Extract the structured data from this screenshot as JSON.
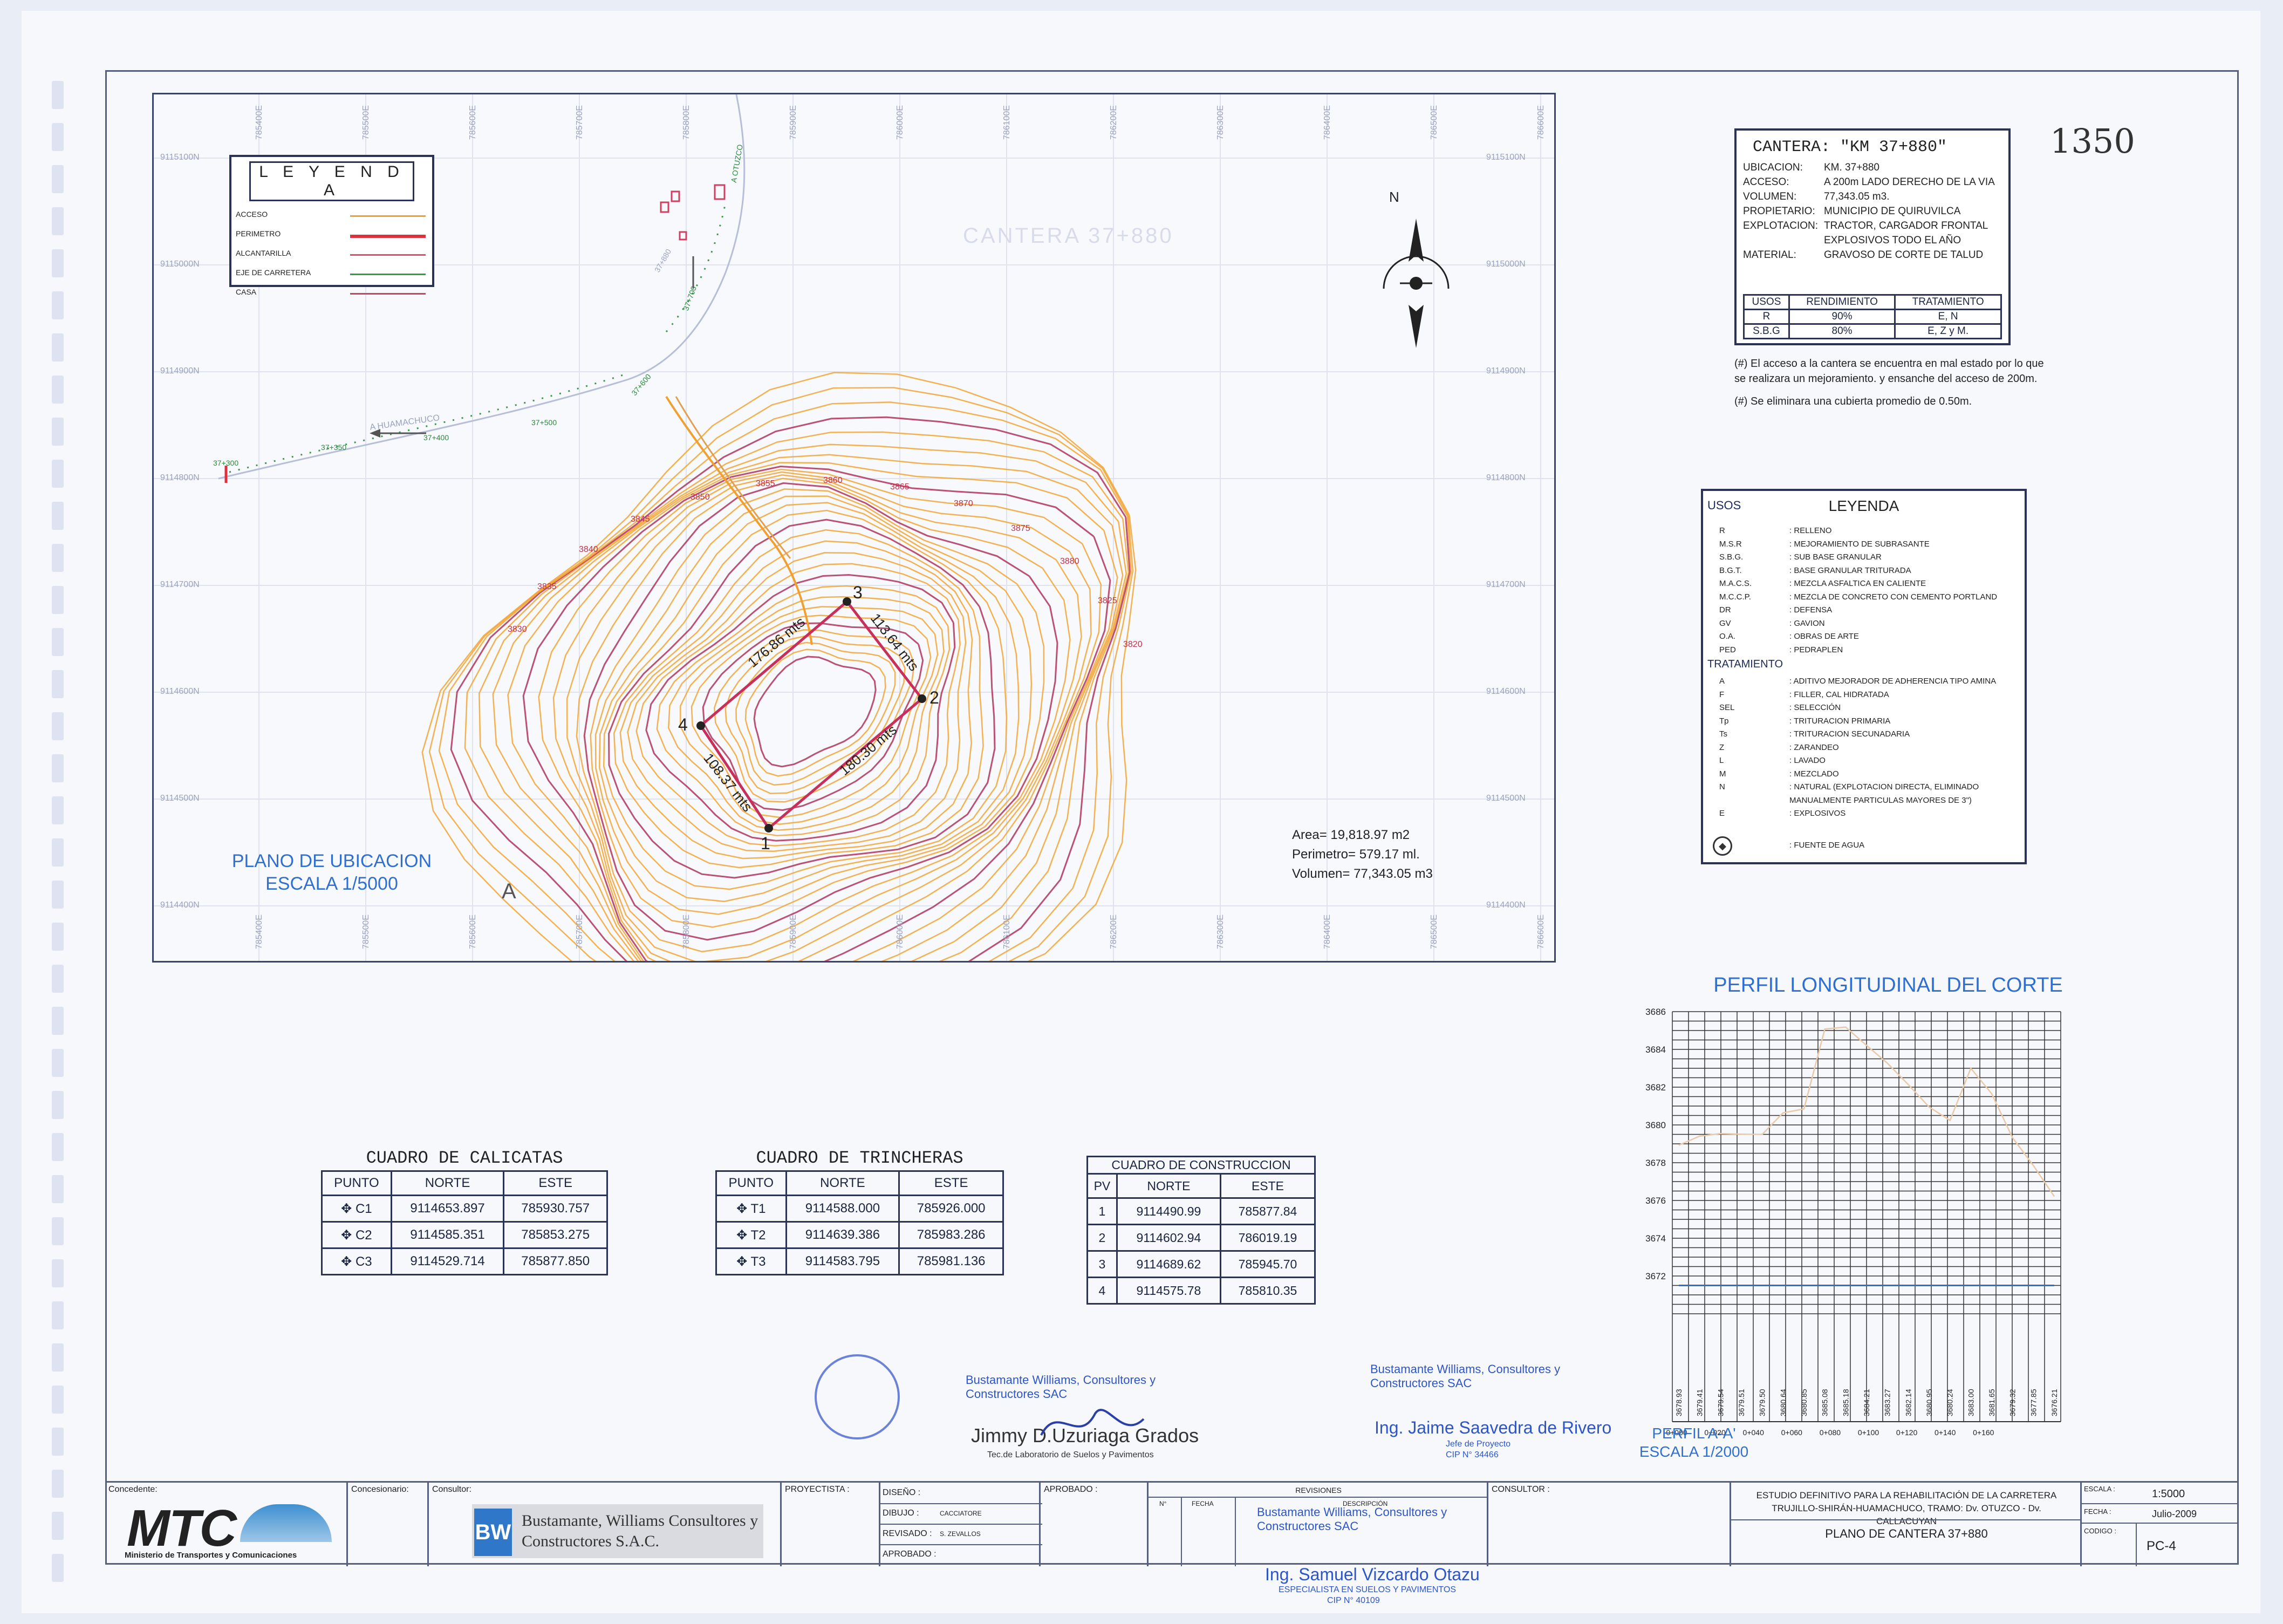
{
  "sheet_number": "1350",
  "map": {
    "north_label": "N",
    "legend_title": "L E Y E N D A",
    "legend_items": [
      {
        "label": "ACCESO",
        "color": "#f0a030"
      },
      {
        "label": "PERIMETRO",
        "color": "#e03040"
      },
      {
        "label": "ALCANTARILLA",
        "color": "#e84a6a"
      },
      {
        "label": "EJE DE CARRETERA",
        "color": "#30a040"
      },
      {
        "label": "CASA",
        "color": "#d04060"
      }
    ],
    "faint_title": "CANTERA 37+880",
    "easting_ticks": [
      "785400E",
      "785500E",
      "785600E",
      "785700E",
      "785800E",
      "785900E",
      "786000E",
      "786100E",
      "786200E",
      "786300E",
      "786400E",
      "786500E",
      "786600E"
    ],
    "northing_ticks": [
      "9115100N",
      "9115000N",
      "9114900N",
      "9114800N",
      "9114700N",
      "9114600N",
      "9114500N",
      "9114400N"
    ],
    "road_labels": [
      "37+300",
      "37+350",
      "37+400",
      "37+500",
      "37+600",
      "37+700",
      "A OTUZCO",
      "A HUAMACHUCO",
      "37+880"
    ],
    "distances": [
      "176.86 mts",
      "113.64 mts",
      "180.30 mts",
      "108.37 mts"
    ],
    "vertices": [
      "1",
      "2",
      "3",
      "4"
    ],
    "section_label": "A",
    "stats": [
      "Area= 19,818.97 m2",
      "Perimetro= 579.17 ml.",
      "Volumen= 77,343.05 m3"
    ],
    "title": "PLANO DE UBICACION",
    "scale": "ESCALA 1/5000",
    "contour_labels": [
      "3830",
      "3835",
      "3840",
      "3845",
      "3850",
      "3855",
      "3860",
      "3865",
      "3870",
      "3875",
      "3880",
      "3825",
      "3820"
    ]
  },
  "cantera": {
    "title": "CANTERA: \"KM 37+880\"",
    "rows": [
      {
        "key": "UBICACION:",
        "val": "KM. 37+880"
      },
      {
        "key": "ACCESO:",
        "val": "A 200m LADO DERECHO DE LA VIA"
      },
      {
        "key": "VOLUMEN:",
        "val": "77,343.05 m3."
      },
      {
        "key": "PROPIETARIO:",
        "val": "MUNICIPIO DE QUIRUVILCA"
      },
      {
        "key": "EXPLOTACION:",
        "val": "TRACTOR, CARGADOR FRONTAL"
      },
      {
        "key": "",
        "val": "EXPLOSIVOS TODO EL AÑO"
      },
      {
        "key": "MATERIAL:",
        "val": "GRAVOSO DE CORTE DE TALUD"
      }
    ],
    "usos_headers": [
      "USOS",
      "RENDIMIENTO",
      "TRATAMIENTO"
    ],
    "usos_rows": [
      [
        "R",
        "90%",
        "E, N"
      ],
      [
        "S.B.G",
        "80%",
        "E, Z y M."
      ]
    ],
    "notes": [
      "(#) El acceso a la cantera se encuentra en mal estado por lo que se realizara un mejoramiento. y ensanche del acceso de 200m.",
      "(#) Se eliminara una cubierta promedio de 0.50m."
    ]
  },
  "leyenda": {
    "usos_label": "USOS",
    "title": "LEYENDA",
    "usos": [
      [
        "R",
        ": RELLENO"
      ],
      [
        "M.S.R",
        ": MEJORAMIENTO DE SUBRASANTE"
      ],
      [
        "S.B.G.",
        ": SUB BASE GRANULAR"
      ],
      [
        "B.G.T.",
        ": BASE GRANULAR TRITURADA"
      ],
      [
        "M.A.C.S.",
        ": MEZCLA ASFALTICA EN CALIENTE"
      ],
      [
        "M.C.C.P.",
        ": MEZCLA DE CONCRETO CON CEMENTO PORTLAND"
      ],
      [
        "DR",
        ": DEFENSA"
      ],
      [
        "GV",
        ": GAVION"
      ],
      [
        "O.A.",
        ": OBRAS DE ARTE"
      ],
      [
        "PED",
        ": PEDRAPLEN"
      ]
    ],
    "tratamiento_label": "TRATAMIENTO",
    "tratamiento": [
      [
        "A",
        ": ADITIVO MEJORADOR DE ADHERENCIA TIPO AMINA"
      ],
      [
        "F",
        ": FILLER, CAL HIDRATADA"
      ],
      [
        "SEL",
        ": SELECCIÓN"
      ],
      [
        "Tp",
        ": TRITURACION PRIMARIA"
      ],
      [
        "Ts",
        ": TRITURACION SECUNADARIA"
      ],
      [
        "Z",
        ": ZARANDEO"
      ],
      [
        "L",
        ": LAVADO"
      ],
      [
        "M",
        ": MEZCLADO"
      ],
      [
        "N",
        ": NATURAL (EXPLOTACION DIRECTA, ELIMINADO"
      ],
      [
        "",
        "MANUALMENTE PARTICULAS MAYORES DE 3\")"
      ],
      [
        "E",
        ": EXPLOSIVOS"
      ]
    ],
    "fuente": ": FUENTE DE AGUA"
  },
  "calicatas": {
    "title": "CUADRO DE CALICATAS",
    "headers": [
      "PUNTO",
      "NORTE",
      "ESTE"
    ],
    "rows": [
      [
        "C1",
        "9114653.897",
        "785930.757"
      ],
      [
        "C2",
        "9114585.351",
        "785853.275"
      ],
      [
        "C3",
        "9114529.714",
        "785877.850"
      ]
    ]
  },
  "trincheras": {
    "title": "CUADRO DE TRINCHERAS",
    "headers": [
      "PUNTO",
      "NORTE",
      "ESTE"
    ],
    "rows": [
      [
        "T1",
        "9114588.000",
        "785926.000"
      ],
      [
        "T2",
        "9114639.386",
        "785983.286"
      ],
      [
        "T3",
        "9114583.795",
        "785981.136"
      ]
    ]
  },
  "construccion": {
    "title": "CUADRO DE CONSTRUCCION",
    "headers": [
      "PV",
      "NORTE",
      "ESTE"
    ],
    "rows": [
      [
        "1",
        "9114490.99",
        "785877.84"
      ],
      [
        "2",
        "9114602.94",
        "786019.19"
      ],
      [
        "3",
        "9114689.62",
        "785945.70"
      ],
      [
        "4",
        "9114575.78",
        "785810.35"
      ]
    ]
  },
  "chart_data": {
    "type": "line",
    "title": "PERFIL LONGITUDINAL DEL CORTE",
    "y_ticks": [
      "3686",
      "3684",
      "3682",
      "3680",
      "3678",
      "3676",
      "3674",
      "3672"
    ],
    "ylim": [
      3670,
      3686
    ],
    "x_ticks": [
      "0+000",
      "0+020",
      "0+040",
      "0+060",
      "0+080",
      "0+100",
      "0+120",
      "0+140",
      "0+160"
    ],
    "cota_labels": [
      "3678.93",
      "3679.41",
      "3679.54",
      "3679.51",
      "3679.50",
      "3680.64",
      "3680.85",
      "3685.08",
      "3685.18",
      "3684.21",
      "3683.27",
      "3682.14",
      "3680.95",
      "3680.24",
      "3683.00",
      "3681.65",
      "3679.32",
      "3677.85",
      "3676.21"
    ],
    "series": [
      {
        "values": [
          3678.93,
          3679.41,
          3679.54,
          3679.51,
          3679.5,
          3680.64,
          3680.85,
          3685.08,
          3685.18,
          3684.21,
          3683.27,
          3682.14,
          3680.95,
          3680.24,
          3683.0,
          3681.65,
          3679.32,
          3677.85,
          3676.21
        ]
      },
      {
        "values": [
          3671.5,
          3671.5,
          3671.5,
          3671.5,
          3671.5,
          3671.5,
          3671.5,
          3671.5,
          3671.5,
          3671.5,
          3671.5,
          3671.5,
          3671.5,
          3671.5,
          3671.5,
          3671.5,
          3671.5,
          3671.5,
          3671.5
        ]
      }
    ],
    "caption": "PERFIL A-A'",
    "scale": "ESCALA 1/2000"
  },
  "signatures": {
    "lab_company": "Bustamante Williams, Consultores y Constructores SAC",
    "lab_name": "Jimmy D.Uzuriaga Grados",
    "lab_role": "Tec.de Laboratorio de Suelos y Pavimentos",
    "proj_company": "Bustamante Williams, Consultores y Constructores SAC",
    "proj_name": "Ing. Jaime Saavedra de Rivero",
    "proj_role": "Jefe de Proyecto",
    "proj_cip": "CIP N° 34466",
    "spec_company": "Bustamante Williams, Consultores y Constructores SAC",
    "spec_name": "Ing. Samuel Vizcardo Otazu",
    "spec_role": "ESPECIALISTA EN SUELOS Y PAVIMENTOS",
    "spec_cip": "CIP N° 40109"
  },
  "titleblock": {
    "concedente_label": "Concedente:",
    "mtc_logo": "MTC",
    "mtc_sub": "Ministerio de Transportes y Comunicaciones",
    "concesionario_label": "Concesionario:",
    "consultor_label": "Consultor:",
    "bw_company": "Bustamante, Williams Consultores y Constructores S.A.C.",
    "proyectista_label": "PROYECTISTA :",
    "diseno_label": "DISEÑO :",
    "dibujo_label": "DIBUJO :",
    "dibujo_val": "CACCIATORE",
    "revisado_label": "REVISADO :",
    "revisado_val": "S. ZEVALLOS",
    "aprobado_label": "APROBADO :",
    "aprobado2_label": "APROBADO :",
    "revisiones_label": "REVISIONES",
    "n_label": "N°",
    "fecha_col": "FECHA",
    "descripcion_label": "DESCRIPCIÓN",
    "consultor2_label": "CONSULTOR :",
    "study": "ESTUDIO DEFINITIVO PARA LA REHABILITACIÓN DE LA CARRETERA TRUJILLO-SHIRÁN-HUAMACHUCO, TRAMO: Dv. OTUZCO - Dv. CALLACUYAN",
    "plan": "PLANO DE CANTERA 37+880",
    "escala_label": "ESCALA :",
    "escala_val": "1:5000",
    "fecha_label": "FECHA :",
    "fecha_val": "Julio-2009",
    "codigo_label": "CODIGO :",
    "codigo_val": "PC-4"
  }
}
